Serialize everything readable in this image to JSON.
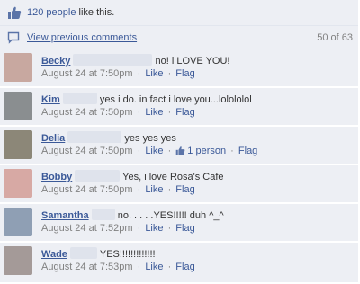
{
  "likes": {
    "link": "120 people",
    "text": " like this."
  },
  "prev": {
    "label": "View previous comments",
    "count": "50 of 63"
  },
  "actions": {
    "like": "Like",
    "flag": "Flag",
    "sep": "·"
  },
  "comments": [
    {
      "author": "Becky",
      "text": "no! i LOVE YOU!",
      "time": "August 24 at 7:50pm",
      "avatar_color": "#c8a8a0"
    },
    {
      "author": "Kim",
      "text": "yes i do. in fact i love you...lolololol",
      "time": "August 24 at 7:50pm",
      "avatar_color": "#8a8e90"
    },
    {
      "author": "Delia",
      "text": "yes yes yes",
      "time": "August 24 at 7:50pm",
      "liked": "1 person",
      "avatar_color": "#8c8778"
    },
    {
      "author": "Bobby",
      "text": "Yes, i love Rosa's Cafe",
      "time": "August 24 at 7:50pm",
      "avatar_color": "#d7a9a4"
    },
    {
      "author": "Samantha",
      "text": "no. . . . .YES!!!!! duh ^_^",
      "time": "August 24 at 7:52pm",
      "avatar_color": "#8f9fb4"
    },
    {
      "author": "Wade",
      "text": "YES!!!!!!!!!!!!!",
      "time": "August 24 at 7:53pm",
      "avatar_color": "#a49a98"
    }
  ]
}
